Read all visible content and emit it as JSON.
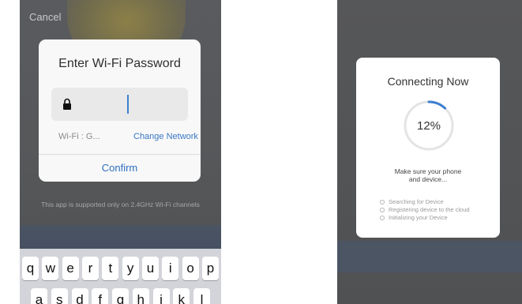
{
  "left_screen": {
    "cancel_label": "Cancel",
    "dialog": {
      "title": "Enter Wi-Fi Password",
      "password_value": "",
      "wifi_label": "Wi-Fi : G...",
      "change_network_label": "Change Network",
      "confirm_label": "Confirm"
    },
    "note": "This app is supported only on 2.4GHz Wi-Fi channels",
    "keyboard": {
      "row1": [
        "q",
        "w",
        "e",
        "r",
        "t",
        "y",
        "u",
        "i",
        "o",
        "p"
      ],
      "row2": [
        "a",
        "s",
        "d",
        "f",
        "g",
        "h",
        "j",
        "k",
        "l"
      ]
    }
  },
  "right_screen": {
    "title": "Connecting Now",
    "progress_label": "12%",
    "progress_value": 0.12,
    "hint_line1": "Make sure your phone",
    "hint_line2": "and device...",
    "steps": [
      "Searching for Device",
      "Registering device to the cloud",
      "Initializing your Device"
    ]
  },
  "colors": {
    "accent": "#3b78c4",
    "progress": "#3d7fd1",
    "overlay": "#56585a"
  },
  "icons": [
    "lock-icon",
    "progress-ring"
  ]
}
